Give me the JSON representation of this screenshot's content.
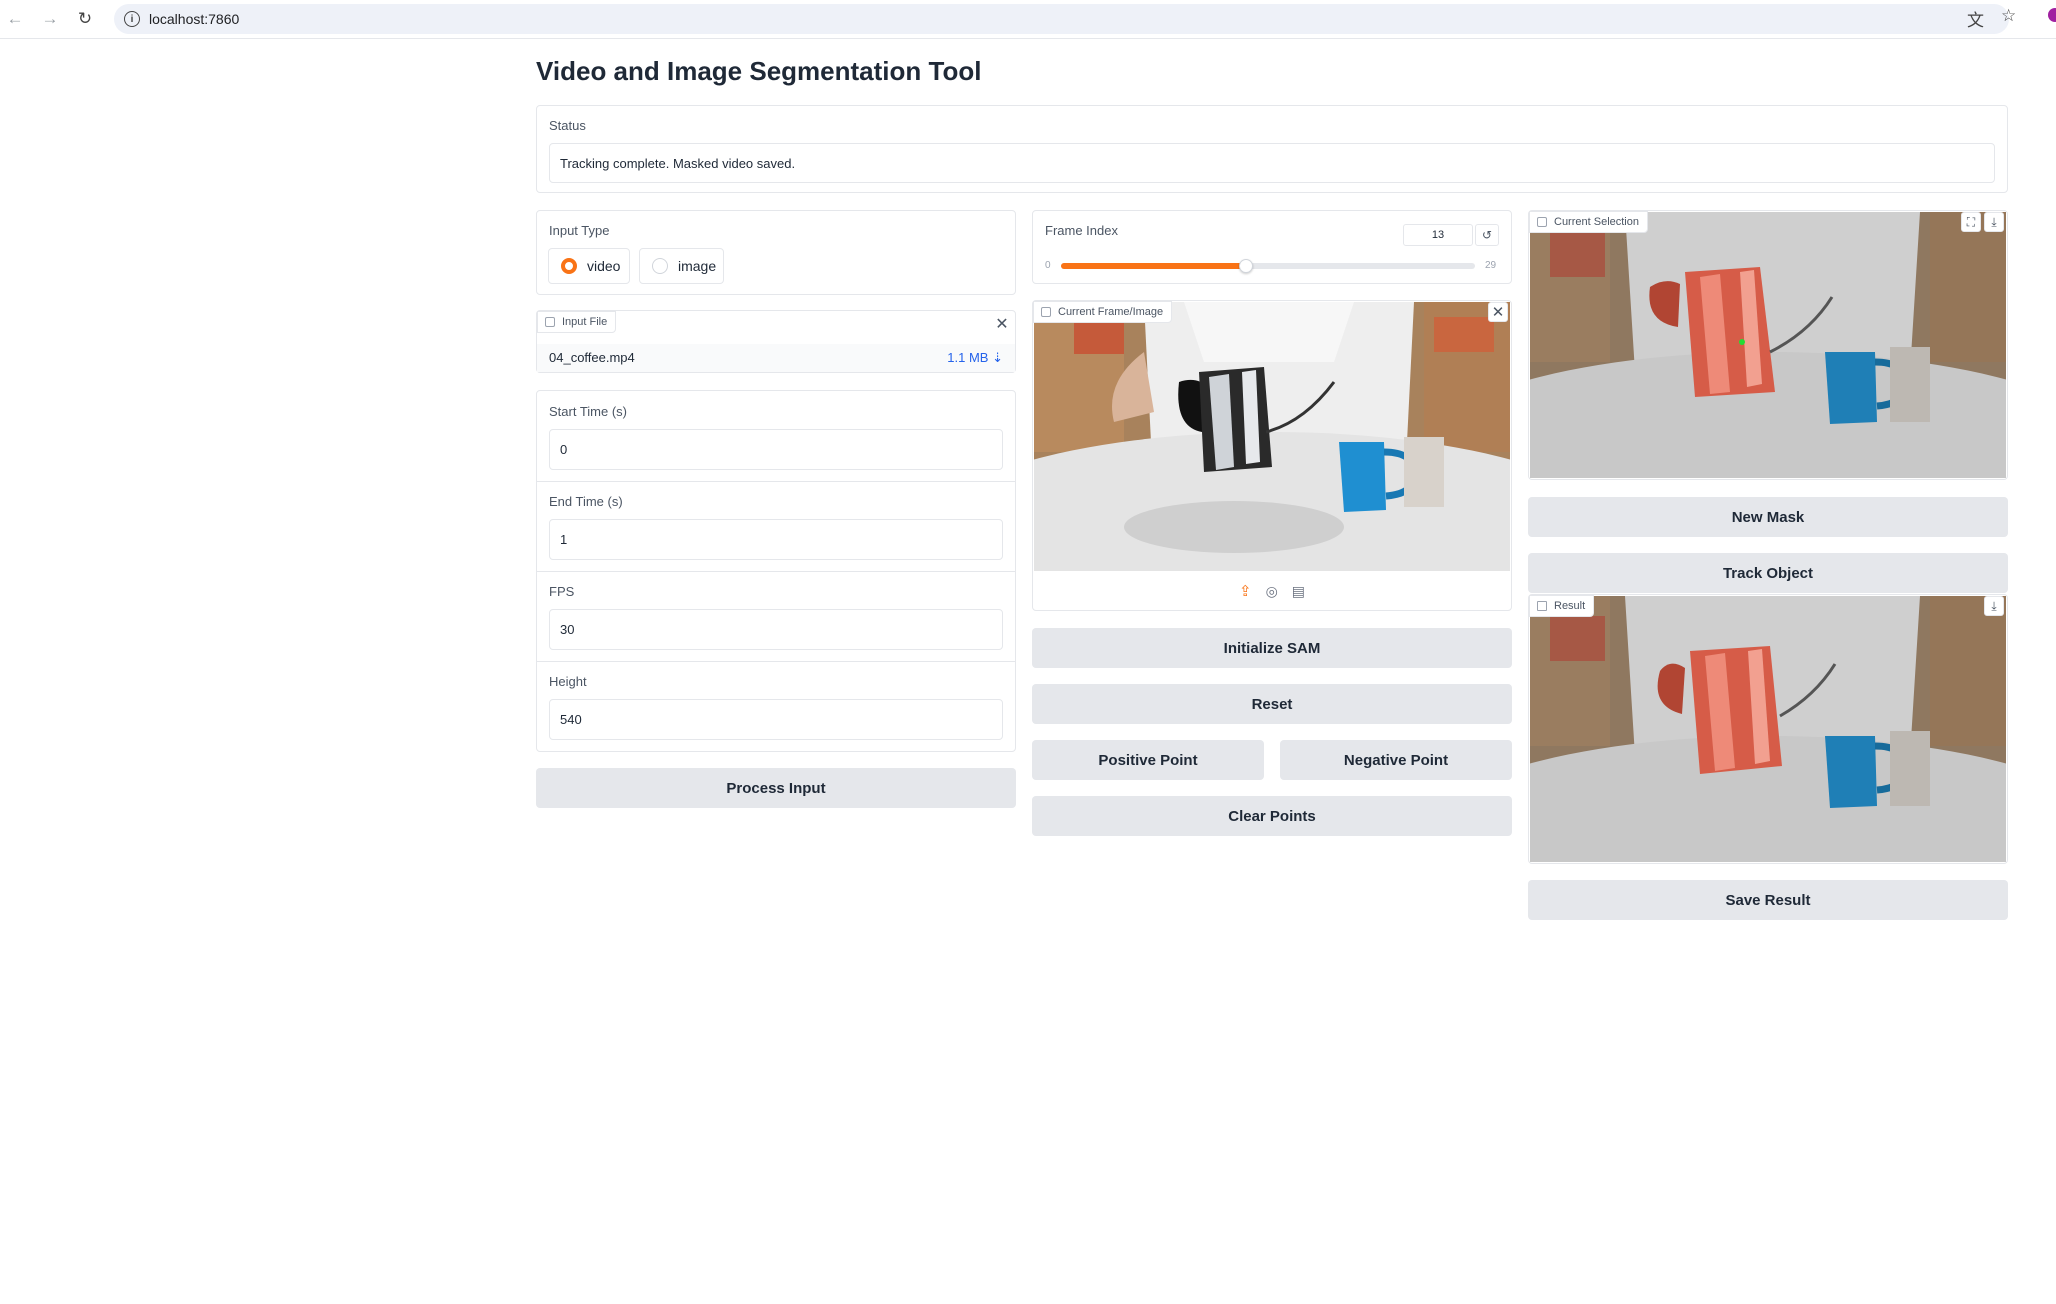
{
  "browser": {
    "url": "localhost:7860"
  },
  "page": {
    "title": "Video and Image Segmentation Tool"
  },
  "status": {
    "label": "Status",
    "value": "Tracking complete. Masked video saved."
  },
  "input_type": {
    "label": "Input Type",
    "options": [
      "video",
      "image"
    ],
    "selected": "video"
  },
  "input_file": {
    "label": "Input File",
    "file_name": "04_coffee.mp4",
    "file_size": "1.1 MB ⇣"
  },
  "params": {
    "start_time": {
      "label": "Start Time (s)",
      "value": "0"
    },
    "end_time": {
      "label": "End Time (s)",
      "value": "1"
    },
    "fps": {
      "label": "FPS",
      "value": "30"
    },
    "height": {
      "label": "Height",
      "value": "540"
    }
  },
  "buttons": {
    "process_input": "Process Input",
    "initialize_sam": "Initialize SAM",
    "reset": "Reset",
    "positive_point": "Positive Point",
    "negative_point": "Negative Point",
    "clear_points": "Clear Points",
    "new_mask": "New Mask",
    "track_object": "Track Object",
    "save_result": "Save Result"
  },
  "frame_index": {
    "label": "Frame Index",
    "value": "13",
    "min": "0",
    "max": "29",
    "fraction": 0.448
  },
  "images": {
    "current_frame_label": "Current Frame/Image",
    "current_selection_label": "Current Selection",
    "result_label": "Result"
  },
  "colors": {
    "accent": "#f97316",
    "button_bg": "#e5e7eb",
    "mask": "#e8584a"
  },
  "icons": [
    "info-icon",
    "back-arrow-icon",
    "forward-arrow-icon",
    "reload-icon",
    "translate-icon",
    "star-icon",
    "file-icon",
    "close-icon",
    "image-icon",
    "upload-icon",
    "webcam-icon",
    "clipboard-icon",
    "fullscreen-icon",
    "download-icon",
    "video-icon",
    "reset-icon"
  ]
}
